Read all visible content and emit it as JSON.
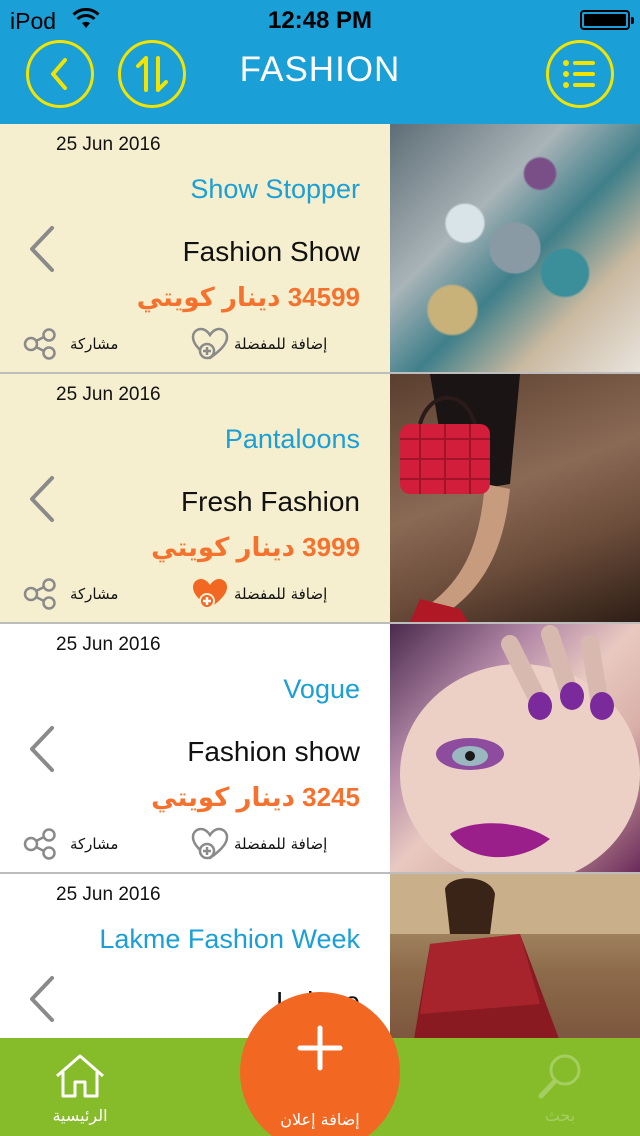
{
  "status": {
    "carrier": "iPod",
    "time": "12:48 PM"
  },
  "header": {
    "title": "FASHION"
  },
  "listings": [
    {
      "date": "25 Jun 2016",
      "store": "Show Stopper",
      "item": "Fashion Show",
      "price": "34599 دينار كويتي",
      "favorite_label": "إضافة للمفضلة",
      "share_label": "مشاركة",
      "favorited": false,
      "highlighted": true,
      "photo": "fabric-embroidery"
    },
    {
      "date": "25 Jun 2016",
      "store": "Pantaloons",
      "item": "Fresh Fashion",
      "price": "3999 دينار كويتي",
      "favorite_label": "إضافة للمفضلة",
      "share_label": "مشاركة",
      "favorited": true,
      "highlighted": true,
      "photo": "red-handbag"
    },
    {
      "date": "25 Jun 2016",
      "store": "Vogue",
      "item": "Fashion show",
      "price": "3245 دينار كويتي",
      "favorite_label": "إضافة للمفضلة",
      "share_label": "مشاركة",
      "favorited": false,
      "highlighted": false,
      "photo": "purple-makeup"
    },
    {
      "date": "25 Jun 2016",
      "store": "Lakme Fashion Week",
      "item": "Lakme",
      "price": "",
      "favorite_label": "",
      "share_label": "",
      "favorited": false,
      "highlighted": false,
      "photo": "bridal-lehenga"
    }
  ],
  "tabbar": {
    "home_label": "الرئيسية",
    "add_label": "إضافة إعلان",
    "search_label": "بحث"
  },
  "colors": {
    "header": "#1a9fd6",
    "icon_yellow": "#f3e300",
    "store_blue": "#1a9fd6",
    "price_orange": "#f5722e",
    "highlight_row": "#f5efcf",
    "tabbar": "#86bb2a",
    "fab": "#f26722",
    "fav_filled": "#f26722"
  }
}
